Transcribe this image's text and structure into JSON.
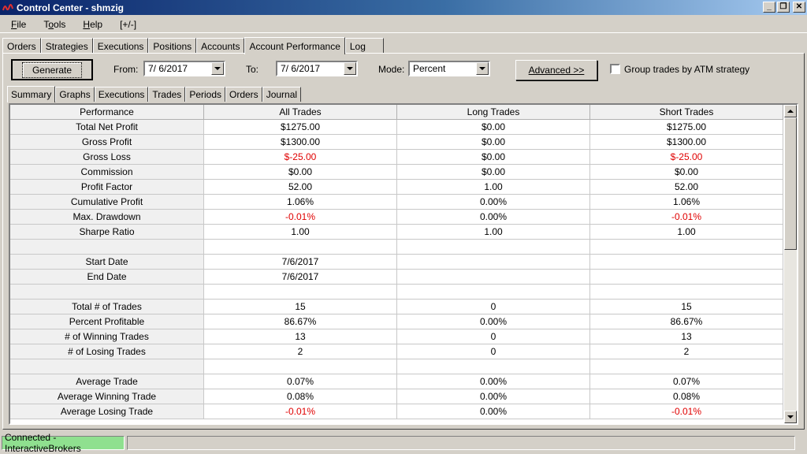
{
  "window": {
    "title": "Control Center - shmzig"
  },
  "menu": [
    "File",
    "Tools",
    "Help",
    "[+/-]"
  ],
  "menu_underline": [
    "F",
    "o",
    "H",
    ""
  ],
  "outer_tabs": [
    "Orders",
    "Strategies",
    "Executions",
    "Positions",
    "Accounts",
    "Account Performance",
    "Log"
  ],
  "outer_active": 5,
  "toolbar": {
    "generate_label": "Generate",
    "from_label": "From:",
    "from_value": "7/ 6/2017",
    "to_label": "To:",
    "to_value": "7/ 6/2017",
    "mode_label": "Mode:",
    "mode_value": "Percent",
    "advanced_label": "Advanced >>",
    "group_label": "Group trades by ATM strategy"
  },
  "inner_tabs": [
    "Summary",
    "Graphs",
    "Executions",
    "Trades",
    "Periods",
    "Orders",
    "Journal"
  ],
  "inner_active": 0,
  "table": {
    "headers": [
      "Performance",
      "All Trades",
      "Long Trades",
      "Short Trades"
    ],
    "rows": [
      {
        "label": "Total Net Profit",
        "values": [
          "$1275.00",
          "$0.00",
          "$1275.00"
        ]
      },
      {
        "label": "Gross Profit",
        "values": [
          "$1300.00",
          "$0.00",
          "$1300.00"
        ]
      },
      {
        "label": "Gross Loss",
        "values": [
          "$-25.00",
          "$0.00",
          "$-25.00"
        ],
        "neg": [
          true,
          false,
          true
        ]
      },
      {
        "label": "Commission",
        "values": [
          "$0.00",
          "$0.00",
          "$0.00"
        ]
      },
      {
        "label": "Profit Factor",
        "values": [
          "52.00",
          "1.00",
          "52.00"
        ]
      },
      {
        "label": "Cumulative Profit",
        "values": [
          "1.06%",
          "0.00%",
          "1.06%"
        ]
      },
      {
        "label": "Max. Drawdown",
        "values": [
          "-0.01%",
          "0.00%",
          "-0.01%"
        ],
        "neg": [
          true,
          false,
          true
        ]
      },
      {
        "label": "Sharpe Ratio",
        "values": [
          "1.00",
          "1.00",
          "1.00"
        ]
      },
      {
        "label": "",
        "values": [
          "",
          "",
          ""
        ]
      },
      {
        "label": "Start Date",
        "values": [
          "7/6/2017",
          "",
          ""
        ]
      },
      {
        "label": "End Date",
        "values": [
          "7/6/2017",
          "",
          ""
        ]
      },
      {
        "label": "",
        "values": [
          "",
          "",
          ""
        ]
      },
      {
        "label": "Total # of Trades",
        "values": [
          "15",
          "0",
          "15"
        ]
      },
      {
        "label": "Percent Profitable",
        "values": [
          "86.67%",
          "0.00%",
          "86.67%"
        ]
      },
      {
        "label": "# of Winning Trades",
        "values": [
          "13",
          "0",
          "13"
        ]
      },
      {
        "label": "# of Losing Trades",
        "values": [
          "2",
          "0",
          "2"
        ]
      },
      {
        "label": "",
        "values": [
          "",
          "",
          ""
        ]
      },
      {
        "label": "Average Trade",
        "values": [
          "0.07%",
          "0.00%",
          "0.07%"
        ]
      },
      {
        "label": "Average Winning Trade",
        "values": [
          "0.08%",
          "0.00%",
          "0.08%"
        ]
      },
      {
        "label": "Average Losing Trade",
        "values": [
          "-0.01%",
          "0.00%",
          "-0.01%"
        ],
        "neg": [
          true,
          false,
          true
        ]
      }
    ]
  },
  "status": {
    "connection": "Connected - InteractiveBrokers"
  },
  "colors": {
    "negative": "#e00000",
    "connected": "#8fe08f",
    "title_start": "#0a246a"
  }
}
